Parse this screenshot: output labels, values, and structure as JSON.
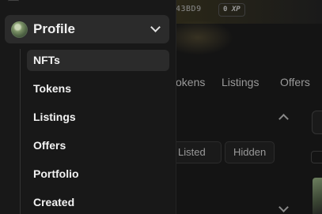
{
  "background": {
    "address": "43BD9",
    "xp": {
      "value": "0",
      "unit": "XP"
    },
    "tabs": [
      "okens",
      "Listings",
      "Offers"
    ],
    "filters": [
      "Listed",
      "Hidden"
    ]
  },
  "sidebar": {
    "profile": {
      "label": "Profile",
      "avatar": "nft-avatar"
    },
    "items": [
      {
        "label": "NFTs",
        "active": true
      },
      {
        "label": "Tokens"
      },
      {
        "label": "Listings"
      },
      {
        "label": "Offers"
      },
      {
        "label": "Portfolio"
      },
      {
        "label": "Created"
      }
    ]
  },
  "colors": {
    "background": "#121212",
    "sidebar": "#181818",
    "active_item": "#2b2b2b",
    "text": "#f2f2f2",
    "muted": "#9a9a9a"
  }
}
